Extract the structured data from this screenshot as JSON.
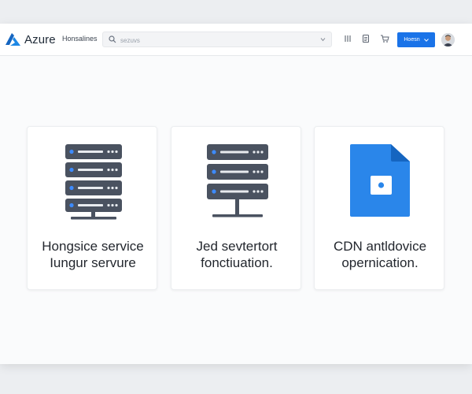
{
  "brand": {
    "name": "Azure",
    "logo_icon": "azure-logo-icon"
  },
  "nav": {
    "link_label": "Honsalines"
  },
  "search": {
    "placeholder": "sezuvs",
    "icon": "search-icon"
  },
  "toolbar": {
    "icons": [
      "columns-icon",
      "document-icon",
      "cart-icon"
    ],
    "account_button_label": "Hoesn"
  },
  "cards": [
    {
      "title_line1": "Hongsice service",
      "title_line2": "Iungur servure",
      "icon": "server-rack-icon"
    },
    {
      "title_line1": "Jed sevtertort",
      "title_line2": "fonctiuation.",
      "icon": "server-rack-icon"
    },
    {
      "title_line1": "CDN antldovice",
      "title_line2": "opernication.",
      "icon": "file-icon"
    }
  ],
  "colors": {
    "accent": "#1a73e8",
    "file_blue": "#2a86ea",
    "server_dark": "#4a5260",
    "server_light": "#e8ebef"
  }
}
